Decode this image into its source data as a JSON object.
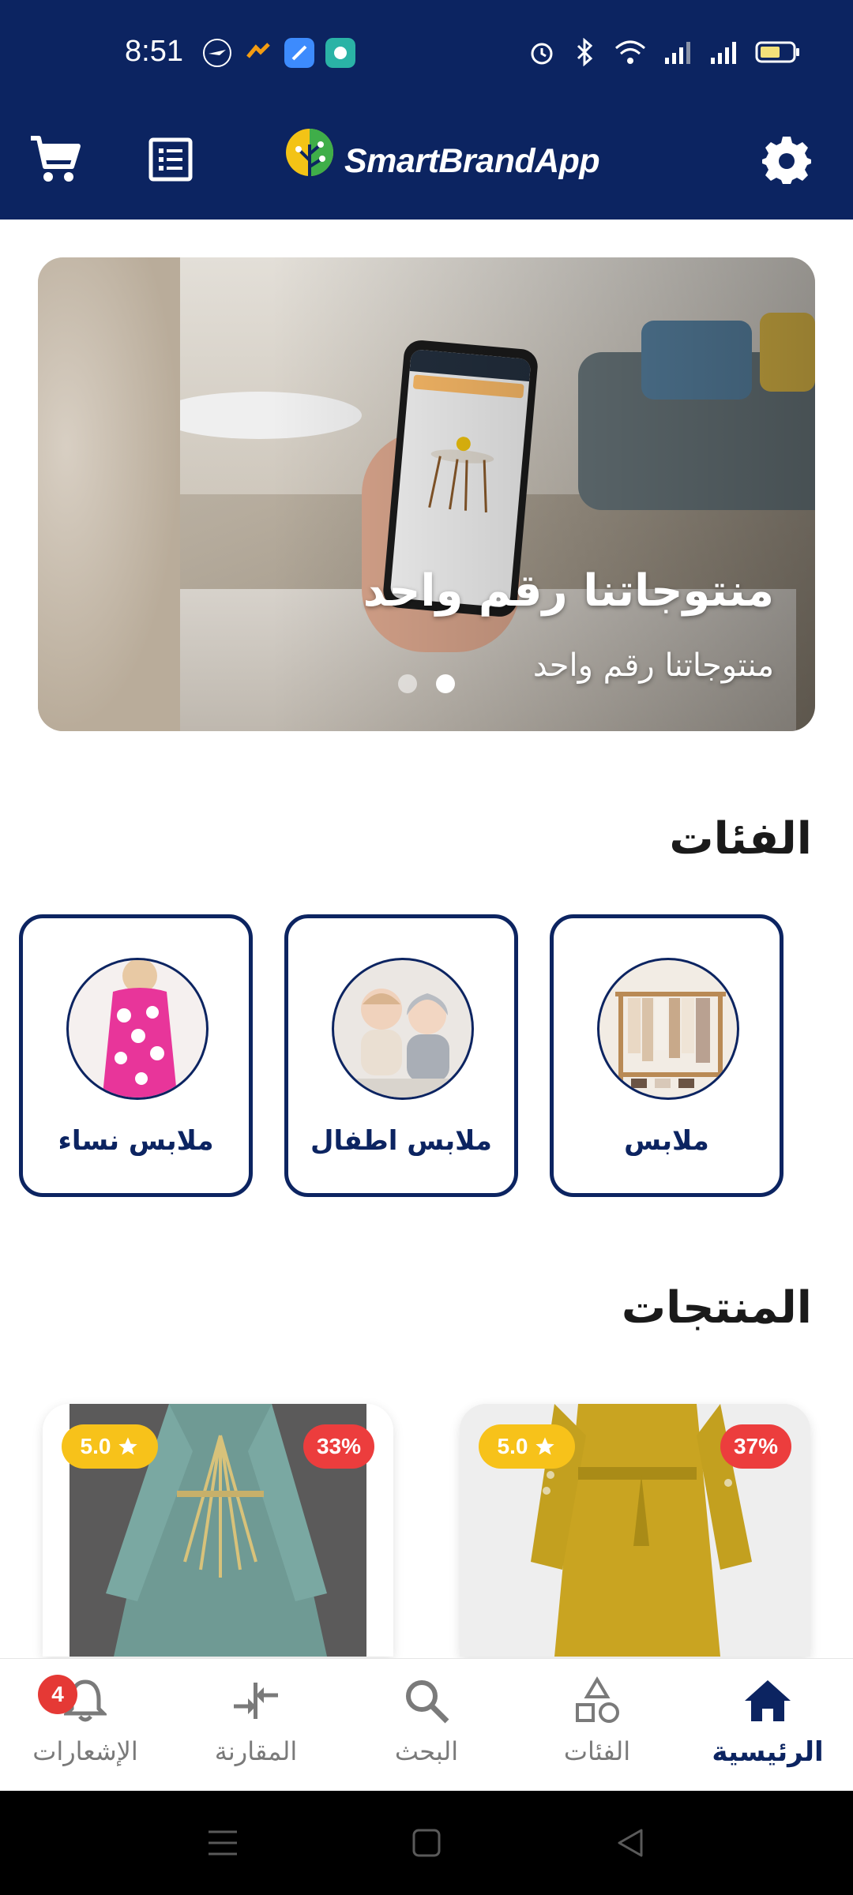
{
  "status_bar": {
    "time": "8:51"
  },
  "header": {
    "brand": "SmartBrandApp",
    "icons": [
      "cart-icon",
      "orders-icon",
      "settings-icon"
    ]
  },
  "banner": {
    "title": "منتوجاتنا رقم واحد",
    "subtitle": "منتوجاتنا رقم واحد",
    "slide_count": 2,
    "active_slide": 2
  },
  "categories": {
    "title": "الفئات",
    "items": [
      {
        "label": "ملابس"
      },
      {
        "label": "ملابس اطفال"
      },
      {
        "label": "ملابس نساء"
      }
    ]
  },
  "products": {
    "title": "المنتجات",
    "items": [
      {
        "rating": "5.0",
        "discount": "37%"
      },
      {
        "rating": "5.0",
        "discount": "33%"
      }
    ]
  },
  "bottom_nav": {
    "items": [
      {
        "label": "الرئيسية",
        "icon": "home-icon",
        "active": true
      },
      {
        "label": "الفئات",
        "icon": "categories-icon"
      },
      {
        "label": "البحث",
        "icon": "search-icon"
      },
      {
        "label": "المقارنة",
        "icon": "compare-icon"
      },
      {
        "label": "الإشعارات",
        "icon": "bell-icon",
        "badge": "4"
      }
    ]
  },
  "colors": {
    "primary": "#0c2461",
    "rating": "#f7c21a",
    "discount": "#ec3d3d",
    "badge": "#e53935"
  }
}
